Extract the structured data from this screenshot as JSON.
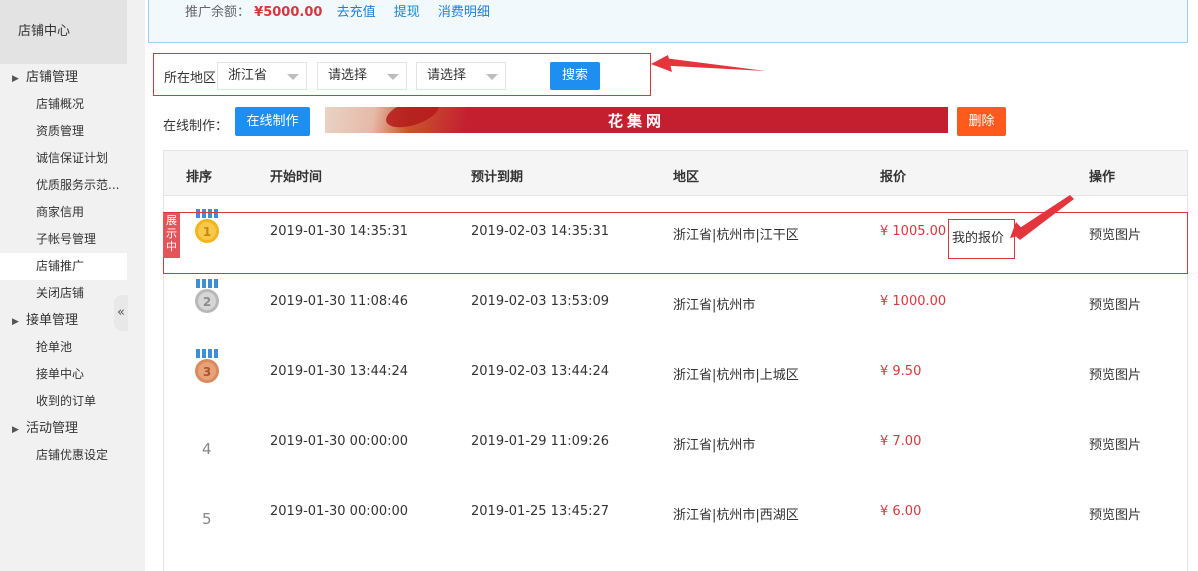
{
  "sidebar": {
    "title": "店铺中心",
    "groups": [
      {
        "label": "店铺管理",
        "items": [
          "店铺概况",
          "资质管理",
          "诚信保证计划",
          "优质服务示范...",
          "商家信用",
          "子帐号管理",
          "店铺推广",
          "关闭店铺"
        ]
      },
      {
        "label": "接单管理",
        "items": [
          "抢单池",
          "接单中心",
          "收到的订单"
        ]
      },
      {
        "label": "活动管理",
        "items": [
          "店铺优惠设定"
        ]
      }
    ],
    "active_item": "店铺推广",
    "collapse_glyph": "«"
  },
  "balance": {
    "label": "推广余额：",
    "amount": "¥5000.00",
    "links": [
      "去充值",
      "提现",
      "消费明细"
    ]
  },
  "filter": {
    "label": "所在地区",
    "province": "浙江省",
    "city": "请选择",
    "district": "请选择",
    "search_label": "搜索"
  },
  "online": {
    "label": "在线制作：",
    "button": "在线制作",
    "banner_text": "花集网",
    "delete_label": "删除"
  },
  "table": {
    "headers": [
      "排序",
      "开始时间",
      "预计到期",
      "地区",
      "报价",
      "操作"
    ],
    "showing_tag": "展示中",
    "my_quote": "我的报价",
    "rows": [
      {
        "rank": "1",
        "start": "2019-01-30 14:35:31",
        "end": "2019-02-03 14:35:31",
        "region": "浙江省|杭州市|江干区",
        "price": "¥ 1005.00",
        "action": "预览图片"
      },
      {
        "rank": "2",
        "start": "2019-01-30 11:08:46",
        "end": "2019-02-03 13:53:09",
        "region": "浙江省|杭州市",
        "price": "¥ 1000.00",
        "action": "预览图片"
      },
      {
        "rank": "3",
        "start": "2019-01-30 13:44:24",
        "end": "2019-02-03 13:44:24",
        "region": "浙江省|杭州市|上城区",
        "price": "¥ 9.50",
        "action": "预览图片"
      },
      {
        "rank": "4",
        "start": "2019-01-30 00:00:00",
        "end": "2019-01-29 11:09:26",
        "region": "浙江省|杭州市",
        "price": "¥ 7.00",
        "action": "预览图片"
      },
      {
        "rank": "5",
        "start": "2019-01-30 00:00:00",
        "end": "2019-01-25 13:45:27",
        "region": "浙江省|杭州市|西湖区",
        "price": "¥ 6.00",
        "action": "预览图片"
      }
    ]
  },
  "colors": {
    "accent_blue": "#1e8ff0",
    "highlight_red": "#d9373f",
    "delete_orange": "#ff5a1e",
    "gold": "#f2b51d",
    "silver": "#b8b8b8",
    "bronze": "#d98b5f"
  }
}
